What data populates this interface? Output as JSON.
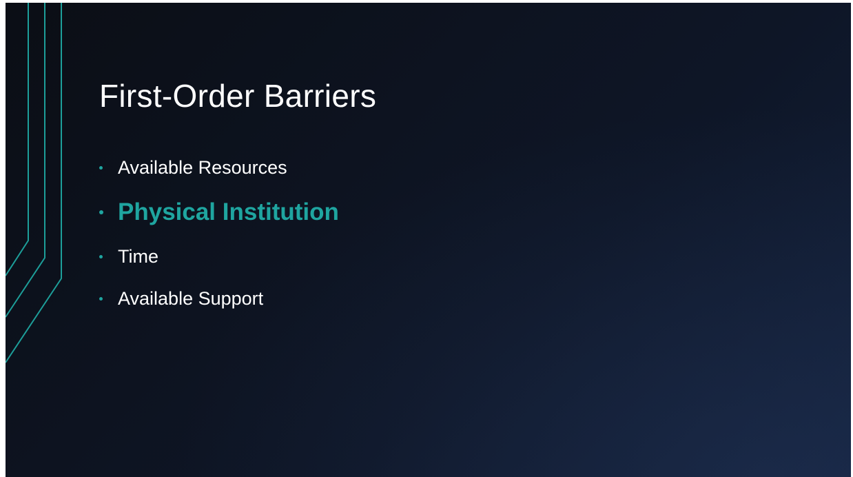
{
  "slide": {
    "title": "First-Order Barriers",
    "accent_color": "#1fa5a0",
    "bullets": [
      {
        "text": "Available Resources",
        "highlighted": false
      },
      {
        "text": "Physical Institution",
        "highlighted": true
      },
      {
        "text": "Time",
        "highlighted": false
      },
      {
        "text": "Available Support",
        "highlighted": false
      }
    ]
  }
}
